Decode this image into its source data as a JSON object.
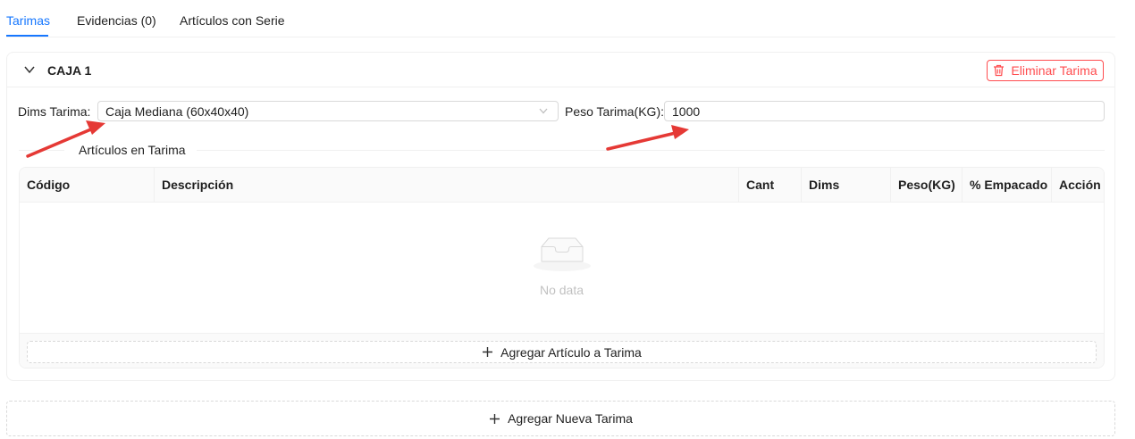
{
  "tabs": [
    {
      "label": "Tarimas",
      "active": true
    },
    {
      "label": "Evidencias (0)",
      "active": false
    },
    {
      "label": "Artículos con Serie",
      "active": false
    }
  ],
  "panel": {
    "title": "CAJA 1",
    "delete_label": "Eliminar Tarima",
    "dims_label": "Dims Tarima",
    "dims_value": "Caja Mediana (60x40x40)",
    "peso_label": "Peso Tarima(KG)",
    "peso_value": "1000",
    "section_title": "Artículos en Tarima"
  },
  "table": {
    "columns": [
      "Código",
      "Descripción",
      "Cant",
      "Dims",
      "Peso(KG)",
      "% Empacado",
      "Acción"
    ],
    "rows": [],
    "empty_text": "No data",
    "add_item_label": "Agregar Artículo a Tarima"
  },
  "add_tarima_label": "Agregar Nueva Tarima",
  "colors": {
    "primary": "#1677ff",
    "danger": "#ff4d4f",
    "annotation_arrow": "#e53935",
    "border": "#f0f0f0"
  },
  "icons": [
    "chevron-down-icon",
    "trash-icon",
    "select-chevron-icon",
    "empty-inbox-icon",
    "plus-icon"
  ]
}
